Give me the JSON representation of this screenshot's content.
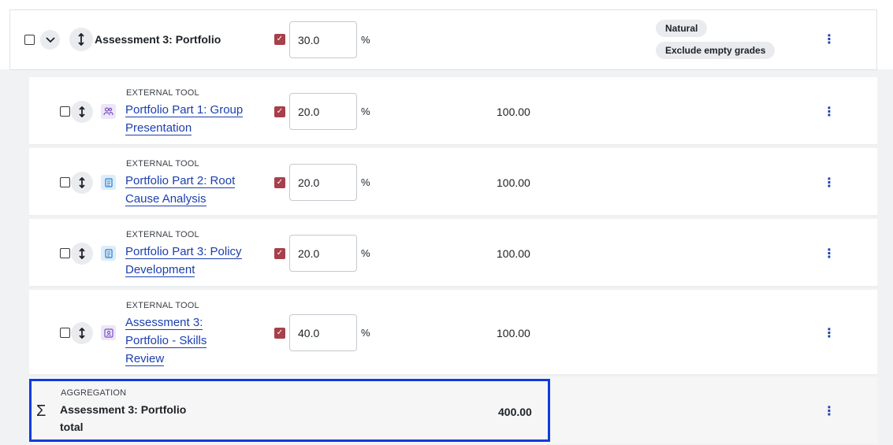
{
  "category": {
    "title": "Assessment 3: Portfolio",
    "weight_value": "30.0",
    "percent_sign": "%",
    "badges": [
      "Natural",
      "Exclude empty grades"
    ]
  },
  "items": [
    {
      "type_label": "EXTERNAL TOOL",
      "name_line1": "Portfolio Part 1: Group",
      "name_line2": "Presentation",
      "name_line3": "",
      "weight_value": "20.0",
      "percent_sign": "%",
      "max_grade": "100.00",
      "icon": "group-icon"
    },
    {
      "type_label": "EXTERNAL TOOL",
      "name_line1": "Portfolio Part 2: Root",
      "name_line2": "Cause Analysis",
      "name_line3": "",
      "weight_value": "20.0",
      "percent_sign": "%",
      "max_grade": "100.00",
      "icon": "document-icon"
    },
    {
      "type_label": "EXTERNAL TOOL",
      "name_line1": "Portfolio Part 3: Policy",
      "name_line2": "Development",
      "name_line3": "",
      "weight_value": "20.0",
      "percent_sign": "%",
      "max_grade": "100.00",
      "icon": "document-icon"
    },
    {
      "type_label": "EXTERNAL TOOL",
      "name_line1": "Assessment 3:",
      "name_line2": "Portfolio - Skills",
      "name_line3": "Review",
      "weight_value": "40.0",
      "percent_sign": "%",
      "max_grade": "100.00",
      "icon": "profile-card-icon"
    }
  ],
  "aggregation": {
    "type_label": "AGGREGATION",
    "title_line1": "Assessment 3: Portfolio",
    "title_line2": "total",
    "total": "400.00"
  },
  "colors": {
    "link": "#1c3fae",
    "weight_checkbox": "#a6404a",
    "highlight_border": "#0f3be0"
  }
}
